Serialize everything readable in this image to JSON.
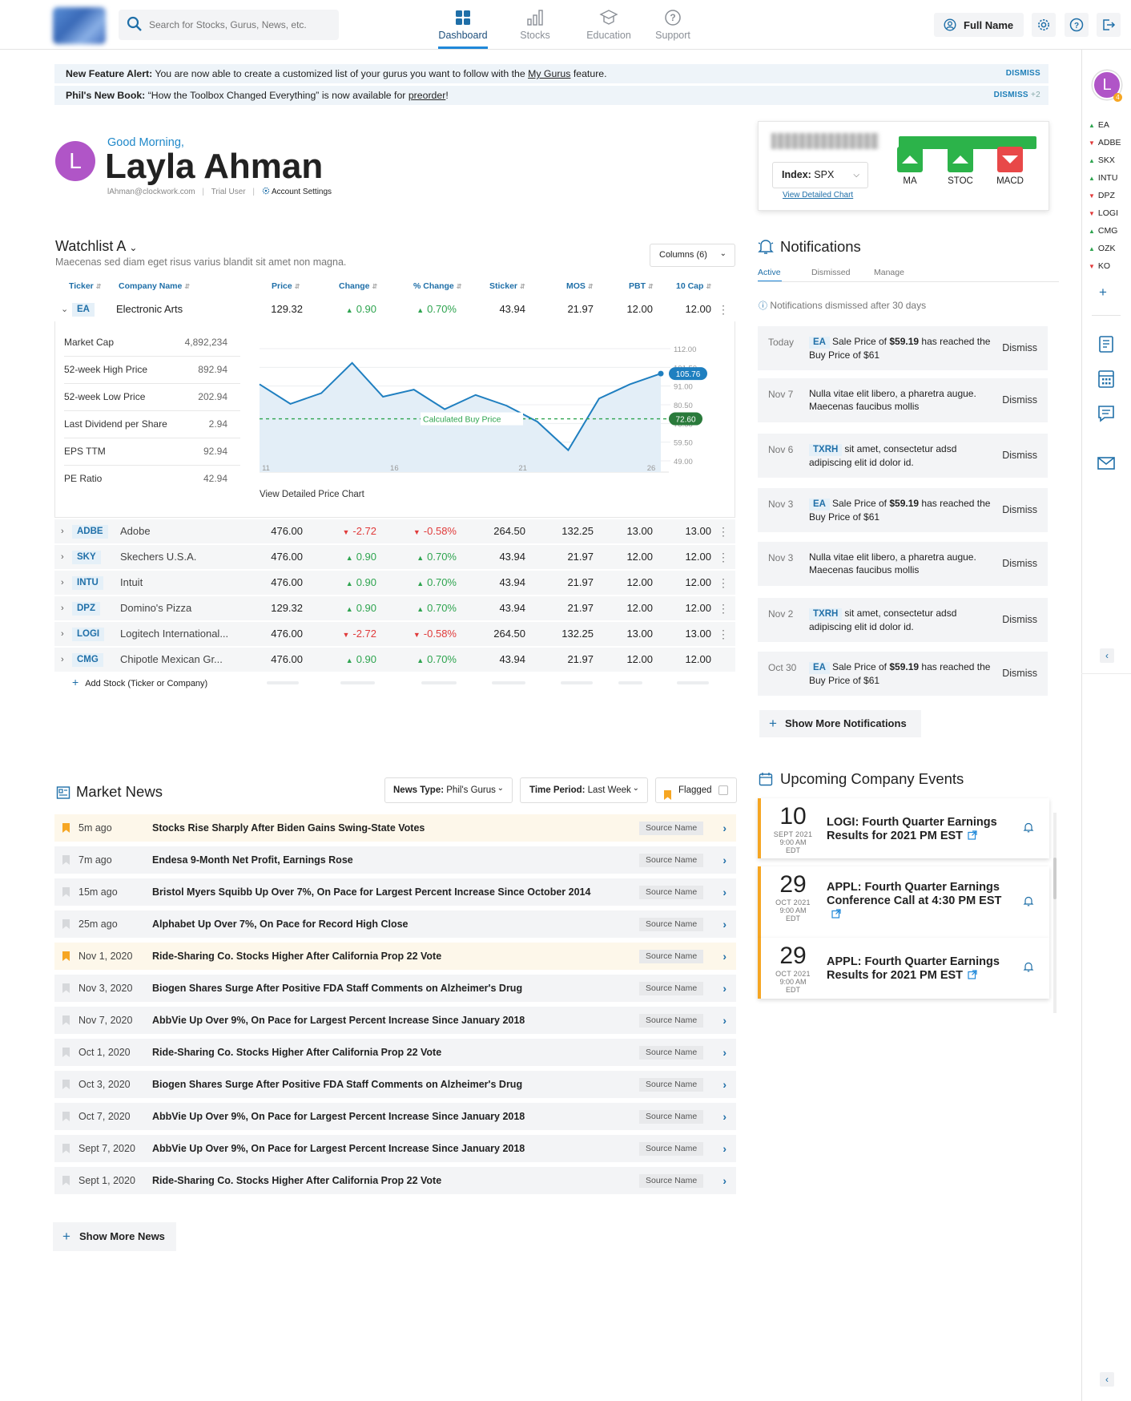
{
  "nav": {
    "search_placeholder": "Search for Stocks, Gurus, News, etc.",
    "items": [
      {
        "label": "Dashboard",
        "icon": "dashboard-icon"
      },
      {
        "label": "Stocks",
        "icon": "bar-chart-icon"
      },
      {
        "label": "Education",
        "icon": "graduation-cap-icon"
      },
      {
        "label": "Support",
        "icon": "help-circle-icon"
      }
    ],
    "active": "Dashboard",
    "user_label": "Full Name"
  },
  "alerts": [
    {
      "bold": "New Feature Alert:",
      "text": " You are now able to create a customized list of your gurus you want to follow with the ",
      "link": "My Gurus",
      "text_after": " feature.",
      "dismiss": "DISMISS",
      "extra": ""
    },
    {
      "bold": "Phil's New Book:",
      "text": " “How the Toolbox Changed Everything” is now available for ",
      "link": "preorder",
      "text_after": "!",
      "dismiss": "DISMISS",
      "extra": "+2"
    }
  ],
  "greeting": {
    "hello": "Good Morning,",
    "name": "Layla Ahman",
    "initial": "L",
    "email": "lAhman@clockwork.com",
    "role": "Trial User",
    "settings": "Account Settings"
  },
  "indicators": {
    "index_label": "Index:",
    "index_value": "SPX",
    "detail_link": "View Detailed Chart",
    "signals": [
      {
        "name": "MA",
        "direction": "up",
        "color": "#2cb34a"
      },
      {
        "name": "STOC",
        "direction": "up",
        "color": "#2cb34a"
      },
      {
        "name": "MACD",
        "direction": "down",
        "color": "#e84848"
      }
    ]
  },
  "watchlist": {
    "title": "Watchlist A",
    "subtitle": "Maecenas sed diam eget risus varius blandit sit amet non magna.",
    "columns_button": "Columns (6)",
    "headers": [
      "Ticker",
      "Company Name",
      "Price",
      "Change",
      "% Change",
      "Sticker",
      "MOS",
      "PBT",
      "10 Cap"
    ],
    "expanded": {
      "ticker": "EA",
      "company": "Electronic Arts",
      "price": "129.32",
      "change": "0.90",
      "pct": "0.70%",
      "sticker": "43.94",
      "mos": "21.97",
      "pbt": "12.00",
      "cap": "12.00",
      "dir": "up",
      "stats": [
        {
          "label": "Market Cap",
          "value": "4,892,234"
        },
        {
          "label": "52-week High Price",
          "value": "892.94"
        },
        {
          "label": "52-week Low Price",
          "value": "202.94"
        },
        {
          "label": "Last Dividend per Share",
          "value": "2.94"
        },
        {
          "label": "EPS TTM",
          "value": "92.94"
        },
        {
          "label": "PE Ratio",
          "value": "42.94"
        }
      ],
      "chart_link": "View Detailed Price Chart"
    },
    "rows": [
      {
        "ticker": "ADBE",
        "company": "Adobe",
        "price": "476.00",
        "change": "-2.72",
        "pct": "-0.58%",
        "sticker": "264.50",
        "mos": "132.25",
        "pbt": "13.00",
        "cap": "13.00",
        "dir": "down"
      },
      {
        "ticker": "SKY",
        "company": "Skechers U.S.A.",
        "price": "476.00",
        "change": "0.90",
        "pct": "0.70%",
        "sticker": "43.94",
        "mos": "21.97",
        "pbt": "12.00",
        "cap": "12.00",
        "dir": "up"
      },
      {
        "ticker": "INTU",
        "company": "Intuit",
        "price": "476.00",
        "change": "0.90",
        "pct": "0.70%",
        "sticker": "43.94",
        "mos": "21.97",
        "pbt": "12.00",
        "cap": "12.00",
        "dir": "up"
      },
      {
        "ticker": "DPZ",
        "company": "Domino's Pizza",
        "price": "129.32",
        "change": "0.90",
        "pct": "0.70%",
        "sticker": "43.94",
        "mos": "21.97",
        "pbt": "12.00",
        "cap": "12.00",
        "dir": "up"
      },
      {
        "ticker": "LOGI",
        "company": "Logitech International...",
        "price": "476.00",
        "change": "-2.72",
        "pct": "-0.58%",
        "sticker": "264.50",
        "mos": "132.25",
        "pbt": "13.00",
        "cap": "13.00",
        "dir": "down"
      },
      {
        "ticker": "CMG",
        "company": "Chipotle Mexican Gr...",
        "price": "476.00",
        "change": "0.90",
        "pct": "0.70%",
        "sticker": "43.94",
        "mos": "21.97",
        "pbt": "12.00",
        "cap": "12.00",
        "dir": "up"
      }
    ],
    "add_stock": "Add Stock (Ticker or Company)"
  },
  "chart_data": {
    "type": "line",
    "x_ticks": [
      11,
      16,
      21,
      26
    ],
    "y_ticks": [
      "112.00",
      "101.50",
      "91.00",
      "80.50",
      "70.00",
      "59.50",
      "49.00"
    ],
    "ylim": [
      49,
      112
    ],
    "values": [
      92,
      81,
      87,
      104,
      85,
      89,
      78,
      86,
      80,
      71,
      55,
      84,
      92,
      98
    ],
    "last_label": "105.76",
    "buy_price": 72.6,
    "buy_label": "72.60",
    "buy_text": "Calculated Buy Price",
    "grid": true
  },
  "notifications": {
    "title": "Notifications",
    "tabs": [
      "Active",
      "Dismissed",
      "Manage"
    ],
    "info": "Notifications dismissed after 30 days",
    "dismiss_label": "Dismiss",
    "items": [
      {
        "date": "Today",
        "ticker": "EA",
        "pre": "Sale Price of ",
        "price": "$59.19",
        "post": " has reached the Buy Price of $61"
      },
      {
        "date": "Nov 7",
        "ticker": "",
        "pre": "Nulla vitae elit libero, a pharetra augue. Maecenas faucibus mollis",
        "price": "",
        "post": ""
      },
      {
        "date": "Nov 6",
        "ticker": "TXRH",
        "pre": "sit amet, consectetur adsd adipiscing elit id dolor id.",
        "price": "",
        "post": ""
      },
      {
        "date": "Nov 3",
        "ticker": "EA",
        "pre": "Sale Price of ",
        "price": "$59.19",
        "post": " has reached the Buy Price of $61"
      },
      {
        "date": "Nov 3",
        "ticker": "",
        "pre": "Nulla vitae elit libero, a pharetra augue. Maecenas faucibus mollis",
        "price": "",
        "post": ""
      },
      {
        "date": "Nov 2",
        "ticker": "TXRH",
        "pre": "sit amet, consectetur adsd adipiscing elit id dolor id.",
        "price": "",
        "post": ""
      },
      {
        "date": "Oct 30",
        "ticker": "EA",
        "pre": "Sale Price of ",
        "price": "$59.19",
        "post": " has reached the Buy Price of $61"
      }
    ],
    "show_more": "Show More Notifications"
  },
  "news": {
    "title": "Market News",
    "type_label": "News Type:",
    "type_value": "Phil's Gurus",
    "period_label": "Time Period:",
    "period_value": "Last Week",
    "flagged_label": "Flagged",
    "source": "Source Name",
    "items": [
      {
        "time": "5m ago",
        "headline": "Stocks Rise Sharply After Biden Gains Swing-State Votes",
        "flagged": true
      },
      {
        "time": "7m ago",
        "headline": "Endesa 9-Month Net Profit, Earnings Rose",
        "flagged": false
      },
      {
        "time": "15m ago",
        "headline": "Bristol Myers Squibb Up Over 7%, On Pace for Largest Percent Increase Since October 2014",
        "flagged": false
      },
      {
        "time": "25m ago",
        "headline": "Alphabet Up Over 7%, On Pace for Record High Close",
        "flagged": false
      },
      {
        "time": "Nov 1, 2020",
        "headline": "Ride-Sharing Co. Stocks Higher After California Prop 22 Vote",
        "flagged": true
      },
      {
        "time": "Nov 3, 2020",
        "headline": "Biogen Shares Surge After Positive FDA Staff Comments on Alzheimer's Drug",
        "flagged": false
      },
      {
        "time": "Nov 7, 2020",
        "headline": "AbbVie Up Over 9%, On Pace for Largest Percent Increase Since January 2018",
        "flagged": false
      },
      {
        "time": "Oct 1, 2020",
        "headline": "Ride-Sharing Co. Stocks Higher After California Prop 22 Vote",
        "flagged": false
      },
      {
        "time": "Oct 3, 2020",
        "headline": "Biogen Shares Surge After Positive FDA Staff Comments on Alzheimer's Drug",
        "flagged": false
      },
      {
        "time": "Oct 7, 2020",
        "headline": "AbbVie Up Over 9%, On Pace for Largest Percent Increase Since January 2018",
        "flagged": false
      },
      {
        "time": "Sept 7, 2020",
        "headline": "AbbVie Up Over 9%, On Pace for Largest Percent Increase Since January 2018",
        "flagged": false
      },
      {
        "time": "Sept 1, 2020",
        "headline": "Ride-Sharing Co. Stocks Higher After California Prop 22 Vote",
        "flagged": false
      }
    ],
    "show_more": "Show More News"
  },
  "events": {
    "title": "Upcoming Company Events",
    "items": [
      {
        "day": "10",
        "month": "SEPT 2021",
        "time": "9:00 AM EDT",
        "title": "LOGI: Fourth Quarter Earnings Results for 2021 PM EST"
      },
      {
        "day": "29",
        "month": "OCT 2021",
        "time": "9:00 AM EDT",
        "title": "APPL: Fourth Quarter Earnings Conference Call at 4:30 PM EST"
      },
      {
        "day": "29",
        "month": "OCT 2021",
        "time": "9:00 AM EDT",
        "title": "APPL: Fourth Quarter Earnings Results for 2021 PM EST"
      }
    ]
  },
  "rail": {
    "initial": "L",
    "badge": "4",
    "tickers": [
      {
        "ticker": "EA",
        "dir": "up"
      },
      {
        "ticker": "ADBE",
        "dir": "down"
      },
      {
        "ticker": "SKX",
        "dir": "up"
      },
      {
        "ticker": "INTU",
        "dir": "up"
      },
      {
        "ticker": "DPZ",
        "dir": "down"
      },
      {
        "ticker": "LOGI",
        "dir": "down"
      },
      {
        "ticker": "CMG",
        "dir": "up"
      },
      {
        "ticker": "OZK",
        "dir": "up"
      },
      {
        "ticker": "KO",
        "dir": "down"
      }
    ]
  },
  "colors": {
    "accent": "#1f88d9",
    "up": "#2ea44f",
    "down": "#e03b3b",
    "flag": "#f6a623",
    "avatar": "#b055c7"
  }
}
